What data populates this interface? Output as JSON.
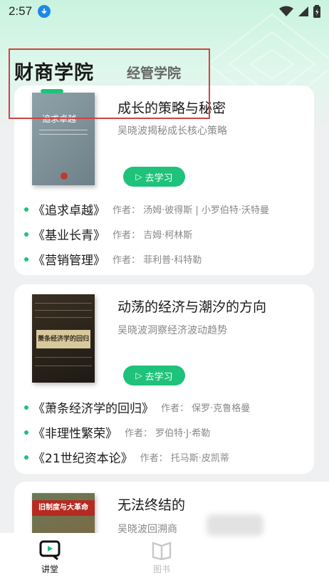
{
  "status_bar": {
    "time": "2:57"
  },
  "tabs": [
    {
      "label": "财商学院",
      "active": true
    },
    {
      "label": "经管学院",
      "active": false
    }
  ],
  "courses": [
    {
      "book_cover_text": "追求卓越",
      "title": "成长的策略与秘密",
      "subtitle": "吴晓波揭秘成长核心策略",
      "button_label": "去学习",
      "recommendations": [
        {
          "name": "《追求卓越》",
          "author": "作者：  汤姆·彼得斯 | 小罗伯特·沃特曼"
        },
        {
          "name": "《基业长青》",
          "author": "作者：  吉姆·柯林斯"
        },
        {
          "name": "《营销管理》",
          "author": "作者：  菲利普·科特勒"
        }
      ]
    },
    {
      "book_cover_text": "萧条经济学的回归",
      "title": "动荡的经济与潮汐的方向",
      "subtitle": "吴晓波洞察经济波动趋势",
      "button_label": "去学习",
      "recommendations": [
        {
          "name": "《萧条经济学的回归》",
          "author": "作者：  保罗·克鲁格曼"
        },
        {
          "name": "《非理性繁荣》",
          "author": "作者：  罗伯特·J·希勒"
        },
        {
          "name": "《21世纪资本论》",
          "author": "作者：  托马斯·皮凯蒂"
        }
      ]
    },
    {
      "book_cover_text": "旧制度与大革命",
      "title": "无法终结的",
      "subtitle": "吴晓波回溯商"
    }
  ],
  "bottom_nav": [
    {
      "label": "讲堂",
      "icon": "tv-icon",
      "active": true
    },
    {
      "label": "图书",
      "icon": "book-icon",
      "active": false
    }
  ],
  "colors": {
    "accent": "#1ec27a",
    "highlight_box": "#cc4444"
  }
}
